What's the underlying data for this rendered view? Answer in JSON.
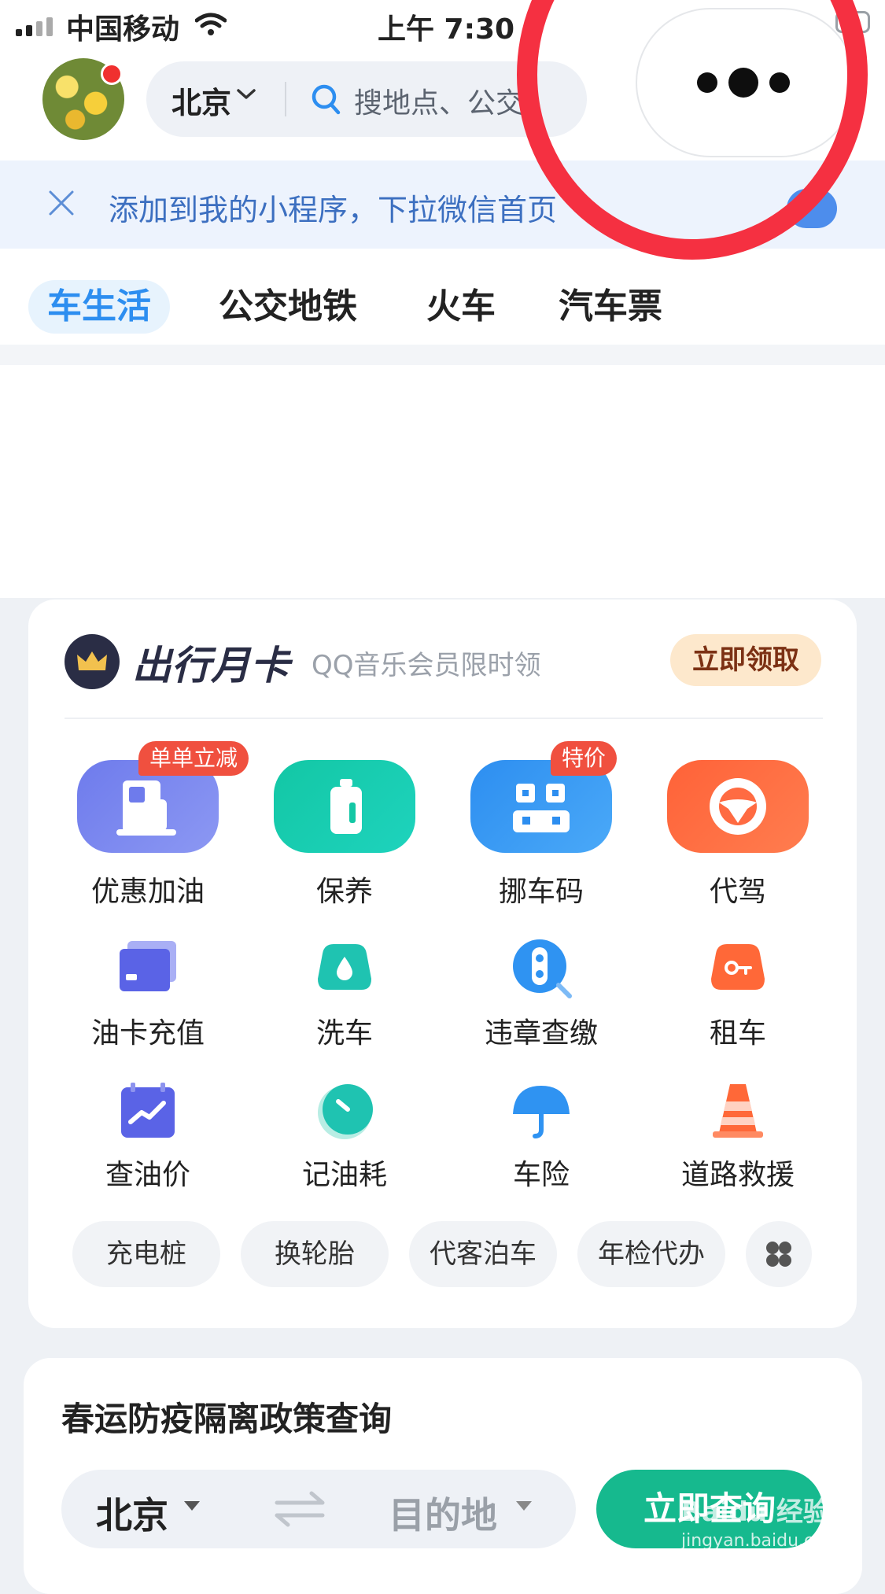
{
  "status_bar": {
    "carrier": "中国移动",
    "time": "上午 7:30"
  },
  "header": {
    "city": "北京",
    "search_placeholder": "搜地点、公交"
  },
  "banner": {
    "text": "添加到我的小程序，下拉微信首页"
  },
  "tabs": [
    {
      "label": "车生活",
      "active": true
    },
    {
      "label": "公交地铁",
      "active": false
    },
    {
      "label": "火车",
      "active": false
    },
    {
      "label": "汽车票",
      "active": false
    }
  ],
  "membership": {
    "title": "出行月卡",
    "subtitle": "QQ音乐会员限时领",
    "claim_label": "立即领取"
  },
  "main_services": [
    {
      "label": "优惠加油",
      "icon": "fuel-pump-icon",
      "tag": "单单立减",
      "color": "#7b86ef"
    },
    {
      "label": "保养",
      "icon": "oil-can-icon",
      "tag": "",
      "color": "#18c7a9"
    },
    {
      "label": "挪车码",
      "icon": "qr-car-icon",
      "tag": "特价",
      "color": "#3a9bf5"
    },
    {
      "label": "代驾",
      "icon": "steering-wheel-icon",
      "tag": "",
      "color": "#ff6b42"
    }
  ],
  "grid_services": [
    {
      "label": "油卡充值",
      "icon": "fuel-card-icon",
      "color": "#5a63e6"
    },
    {
      "label": "洗车",
      "icon": "car-wash-icon",
      "color": "#1fc3b1"
    },
    {
      "label": "违章查缴",
      "icon": "traffic-light-search-icon",
      "color": "#2f93f2"
    },
    {
      "label": "租车",
      "icon": "rental-car-key-icon",
      "color": "#ff6838"
    },
    {
      "label": "查油价",
      "icon": "price-chart-calendar-icon",
      "color": "#5a63e6"
    },
    {
      "label": "记油耗",
      "icon": "timer-icon",
      "color": "#1fc3b1"
    },
    {
      "label": "车险",
      "icon": "umbrella-icon",
      "color": "#2f93f2"
    },
    {
      "label": "道路救援",
      "icon": "traffic-cone-icon",
      "color": "#ff6838"
    }
  ],
  "chips": [
    "充电桩",
    "换轮胎",
    "代客泊车",
    "年检代办"
  ],
  "policy": {
    "title": "春运防疫隔离政策查询",
    "from": "北京",
    "to": "目的地",
    "button": "立即查询"
  },
  "watermark": {
    "text": "Baidu 经验",
    "url": "jingyan.baidu.com"
  }
}
